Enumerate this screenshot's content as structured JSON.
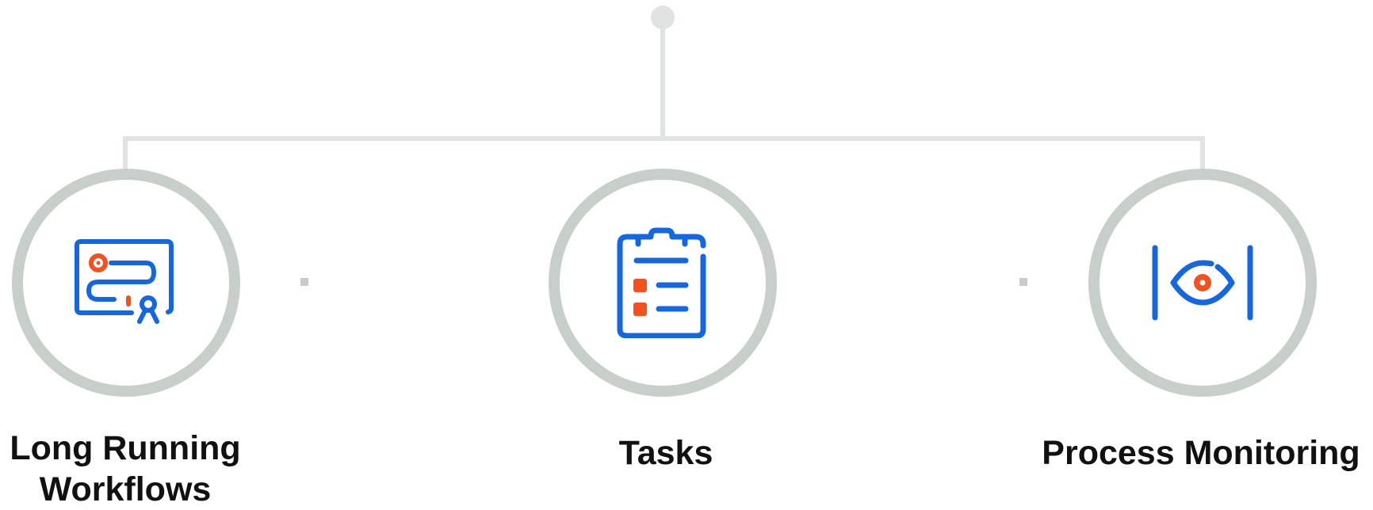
{
  "colors": {
    "connector": "#e1e3e3",
    "ring": "#c8ceca",
    "icon_primary": "#1467e0",
    "icon_accent": "#f4511e",
    "text": "#111111"
  },
  "nodes": [
    {
      "label": "Long Running Workflows",
      "icon": "certificate-icon"
    },
    {
      "label": "Tasks",
      "icon": "clipboard-checklist-icon"
    },
    {
      "label": "Process Monitoring",
      "icon": "eye-monitoring-icon"
    }
  ]
}
